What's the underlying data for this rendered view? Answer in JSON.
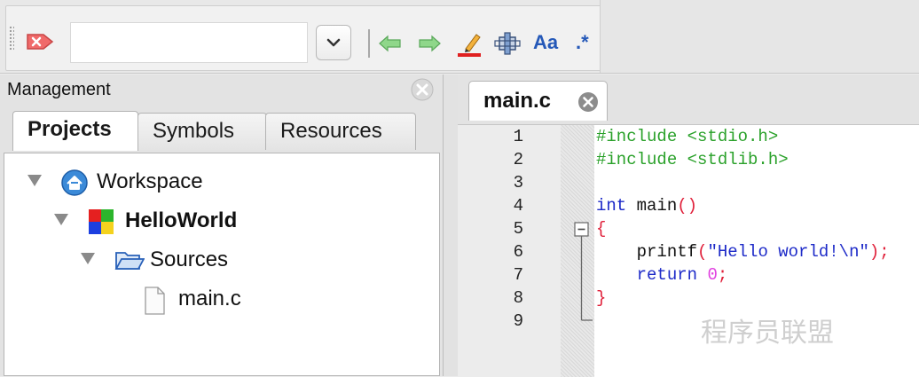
{
  "toolbar": {
    "search_value": "",
    "buttons": [
      "clear-search-icon",
      "dropdown-chevron-icon",
      "find-previous-icon",
      "find-next-icon",
      "highlight-icon",
      "selection-scope-icon",
      "match-case-icon",
      "regex-icon"
    ],
    "match_case_label": "Aa",
    "regex_label": ".*"
  },
  "management": {
    "title": "Management",
    "tabs": [
      {
        "label": "Projects",
        "active": true
      },
      {
        "label": "Symbols",
        "active": false
      },
      {
        "label": "Resources",
        "active": false
      }
    ],
    "tree": [
      {
        "label": "Workspace",
        "icon": "workspace-home-icon",
        "expanded": true,
        "bold": false,
        "level": 0
      },
      {
        "label": "HelloWorld",
        "icon": "project-icon",
        "expanded": true,
        "bold": true,
        "level": 1
      },
      {
        "label": "Sources",
        "icon": "folder-open-icon",
        "expanded": true,
        "bold": false,
        "level": 2
      },
      {
        "label": "main.c",
        "icon": "file-icon",
        "expanded": false,
        "bold": false,
        "level": 3
      }
    ]
  },
  "editor": {
    "tab_label": "main.c",
    "line_numbers": [
      "1",
      "2",
      "3",
      "4",
      "5",
      "6",
      "7",
      "8",
      "9"
    ],
    "lines": [
      [
        {
          "t": "#include <stdio.h>",
          "c": "pp"
        }
      ],
      [
        {
          "t": "#include <stdlib.h>",
          "c": "pp"
        }
      ],
      [],
      [
        {
          "t": "int",
          "c": "kw"
        },
        {
          "t": " main",
          "c": "txt"
        },
        {
          "t": "()",
          "c": "br"
        }
      ],
      [
        {
          "t": "{",
          "c": "br"
        }
      ],
      [
        {
          "t": "    printf",
          "c": "txt"
        },
        {
          "t": "(",
          "c": "br"
        },
        {
          "t": "\"Hello world!\\n\"",
          "c": "str"
        },
        {
          "t": ");",
          "c": "br"
        }
      ],
      [
        {
          "t": "    return",
          "c": "kw"
        },
        {
          "t": " ",
          "c": "txt"
        },
        {
          "t": "0",
          "c": "num"
        },
        {
          "t": ";",
          "c": "br"
        }
      ],
      [
        {
          "t": "}",
          "c": "br"
        }
      ],
      []
    ]
  },
  "watermark": "程序员联盟",
  "colors": {
    "preprocessor": "#2aa12a",
    "keyword": "#1d2ac8",
    "brace": "#e0203a",
    "number": "#e040e0"
  }
}
